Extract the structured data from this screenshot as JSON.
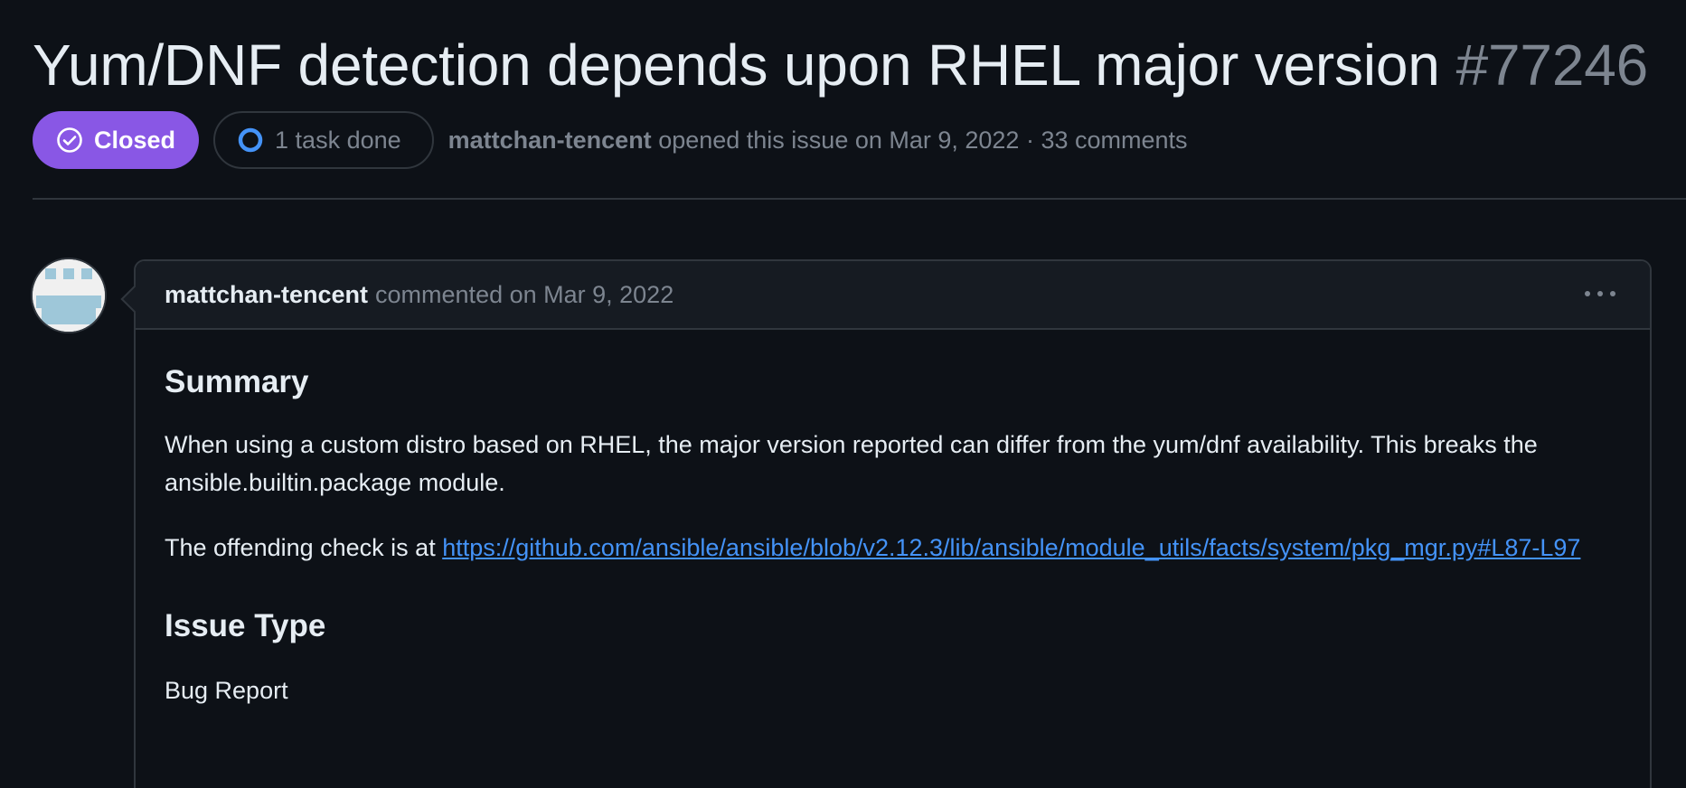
{
  "issue": {
    "title": "Yum/DNF detection depends upon RHEL major version",
    "number": "#77246",
    "state_label": "Closed",
    "task_label": "1 task done",
    "author": "mattchan-tencent",
    "opened_text": "opened this issue on Mar 9, 2022 · 33 comments"
  },
  "comment": {
    "author": "mattchan-tencent",
    "meta": "commented on Mar 9, 2022",
    "sections": {
      "summary_heading": "Summary",
      "summary_text": "When using a custom distro based on RHEL, the major version reported can differ from the yum/dnf availability. This breaks the ansible.builtin.package module.",
      "check_prefix": "The offending check is at ",
      "check_link": "https://github.com/ansible/ansible/blob/v2.12.3/lib/ansible/module_utils/facts/system/pkg_mgr.py#L87-L97",
      "issue_type_heading": "Issue Type",
      "issue_type_text": "Bug Report"
    }
  },
  "colors": {
    "background": "#0d1117",
    "closed_badge": "#8957e5",
    "link": "#4493f8",
    "muted": "#7d8590",
    "border": "#30363d"
  },
  "icons": {
    "state": "check-circle-icon",
    "task": "task-progress-icon",
    "menu": "kebab-horizontal-icon"
  }
}
